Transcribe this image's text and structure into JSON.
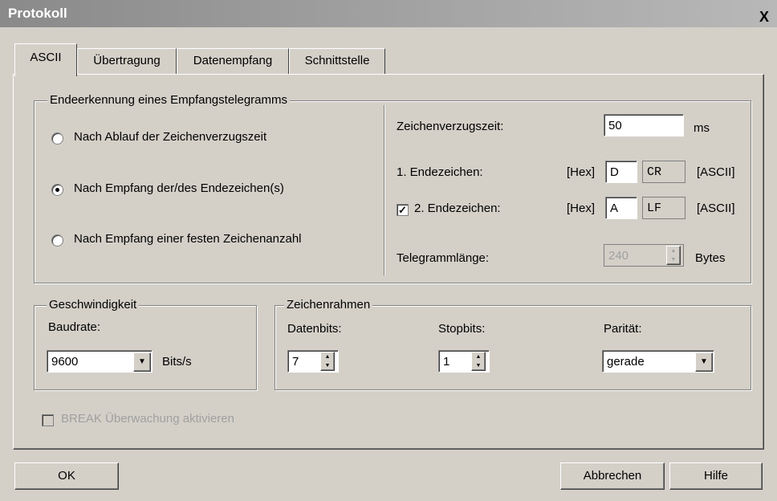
{
  "window": {
    "title": "Protokoll",
    "close_glyph": "X"
  },
  "tabs": [
    "ASCII",
    "Übertragung",
    "Datenempfang",
    "Schnittstelle"
  ],
  "end_detection": {
    "legend": "Endeerkennung eines Empfangstelegramms",
    "options": [
      "Nach Ablauf der Zeichenverzugszeit",
      "Nach Empfang der/des Endezeichen(s)",
      "Nach Empfang einer festen Zeichenanzahl"
    ],
    "selected_index": 1,
    "delay_label": "Zeichenverzugszeit:",
    "delay_value": "50",
    "delay_unit": "ms",
    "end1_label": "1. Endezeichen:",
    "end1_hex_label": "[Hex]",
    "end1_hex": "D",
    "end1_ascii": "CR",
    "end1_ascii_label": "[ASCII]",
    "end2_checked": true,
    "end2_label": "2. Endezeichen:",
    "end2_hex_label": "[Hex]",
    "end2_hex": "A",
    "end2_ascii": "LF",
    "end2_ascii_label": "[ASCII]",
    "length_label": "Telegrammlänge:",
    "length_value": "240",
    "length_unit": "Bytes"
  },
  "speed": {
    "legend": "Geschwindigkeit",
    "baud_label": "Baudrate:",
    "baud_value": "9600",
    "baud_unit": "Bits/s"
  },
  "frame": {
    "legend": "Zeichenrahmen",
    "databits_label": "Datenbits:",
    "databits_value": "7",
    "stopbits_label": "Stopbits:",
    "stopbits_value": "1",
    "parity_label": "Parität:",
    "parity_value": "gerade"
  },
  "break_monitor": {
    "label": "BREAK Überwachung aktivieren",
    "checked": false,
    "enabled": false
  },
  "buttons": {
    "ok": "OK",
    "cancel": "Abbrechen",
    "help": "Hilfe"
  }
}
